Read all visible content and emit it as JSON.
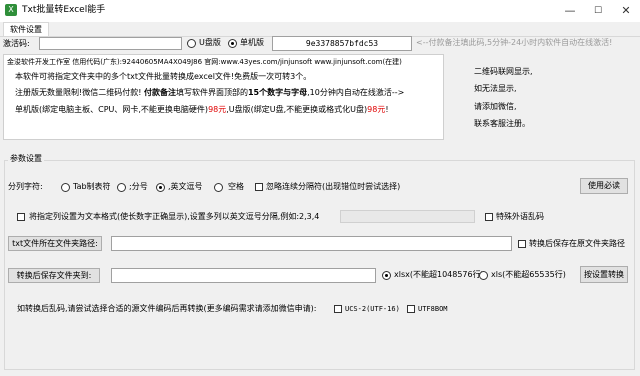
{
  "window": {
    "title": "Txt批量转Excel能手",
    "min": "—",
    "max": "☐",
    "close": "✕"
  },
  "tabs": [
    {
      "label": "软件设置"
    }
  ],
  "activation": {
    "label": "激活码:",
    "code_value": "",
    "radio_usb": "U盘版",
    "radio_pc": "单机版",
    "machine_code": "9e3378857bfdc53",
    "notice": "<--付款备注填此码,5分钟-24小时内软件自动在线激活!"
  },
  "info": {
    "line1": "金浚软件开发工作室 信用代码(广东):92440605MA4X049J86 官网:www.43yes.com/jinjunsoft  www.jinjunsoft.com(在建)",
    "line2": "本软件可将指定文件夹中的多个txt文件批量转换成excel文件!免费版一次可转3个。",
    "line3a": "注册版无数量限制!微信二维码付款!",
    "line3b": "付款备注",
    "line3c": "填写软件界面顶部的",
    "line3d": "15个数字与字母",
    "line3e": ",10分钟内自动在线激活-->",
    "line4a": "单机版(绑定电脑主板、CPU、网卡,不能更换电脑硬件)",
    "line4b": "98元",
    "line4c": ",U盘版(绑定U盘,不能更换或格式化U盘)",
    "line4d": "98元",
    "line4e": "!"
  },
  "qr_text": [
    "二维码联网显示,",
    "如无法显示,",
    "请添加微信,",
    "联系客服注册。"
  ],
  "params": {
    "group_title": "参数设置",
    "delimiter_label": "分列字符:",
    "delim_tab": "Tab制表符",
    "delim_semicolon": ";分号",
    "delim_comma": ",英文逗号",
    "delim_space": "空格",
    "ignore_consecutive": "忽略连续分隔符(出现错位时尝试选择)",
    "help_button": "使用必读",
    "text_format_label": "将指定列设置为文本格式(使长数字正确显示),设置多列以英文逗号分隔,例如:2,3,4",
    "text_format_value": "",
    "foreign_lang": "特殊外语乱码",
    "txt_folder_button": "txt文件所在文件夹路径:",
    "txt_folder_value": "",
    "save_original": "转换后保存在原文件夹路径",
    "save_folder_button": "转换后保存文件夹到:",
    "save_folder_value": "",
    "xlsx_option": "xlsx(不能超1048576行)",
    "xls_option": "xls(不能超65535行)",
    "convert_button": "按设置转换",
    "encoding_hint": "如转换后乱码,请尝试选择合适的源文件编码后再转换(更多编码需求请添加微信申请):",
    "enc_ucs2": "UCS-2(UTF-16)",
    "enc_utf8": "UTF8BOM"
  }
}
